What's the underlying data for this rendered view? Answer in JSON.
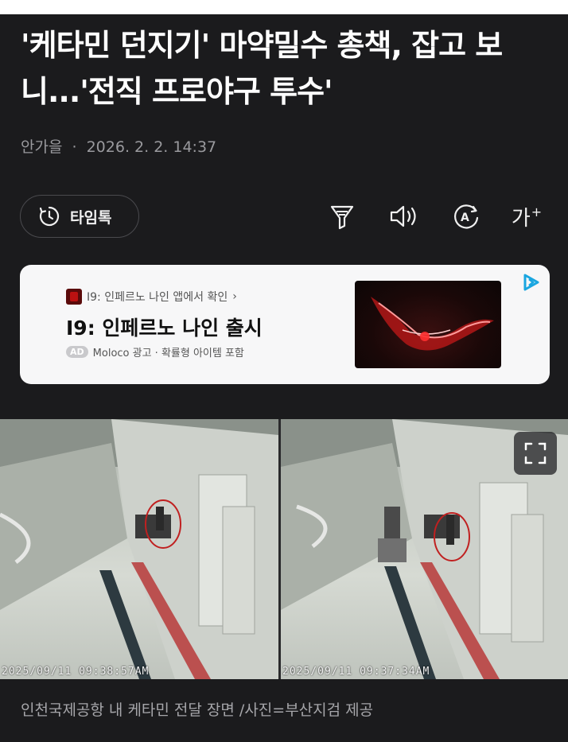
{
  "article": {
    "headline": "'케타민 던지기' 마약밀수 총책, 잡고 보니...'전직 프로야구 투수'",
    "author": "안가을",
    "separator": "·",
    "date": "2026. 2. 2. 14:37"
  },
  "toolbar": {
    "timeline_label": "타임톡",
    "font_size_label": "가",
    "font_size_plus": "+"
  },
  "ad": {
    "app_name": "I9: 인페르노 나인 앱에서 확인",
    "app_chevron": "›",
    "title": "I9: 인페르노 나인 출시",
    "badge": "AD",
    "advertiser": "Moloco 광고 · 확률형 아이템 포함"
  },
  "photos": {
    "left_timestamp": "2025/09/11  09:38:57AM",
    "right_timestamp": "2025/09/11  09:37:34AM",
    "caption": "인천국제공항 내 케타민 전달 장면 /사진=부산지검 제공"
  },
  "colors": {
    "background": "#1b1b1d",
    "text_primary": "#ffffff",
    "text_secondary": "#9a9a9e",
    "ad_background": "#f7f7f8",
    "ad_logo": "#1aa6e0"
  },
  "icons": [
    "clock-icon",
    "filter-icon",
    "speaker-icon",
    "translate-icon",
    "font-size-icon",
    "ad-choices-icon",
    "fullscreen-icon"
  ]
}
